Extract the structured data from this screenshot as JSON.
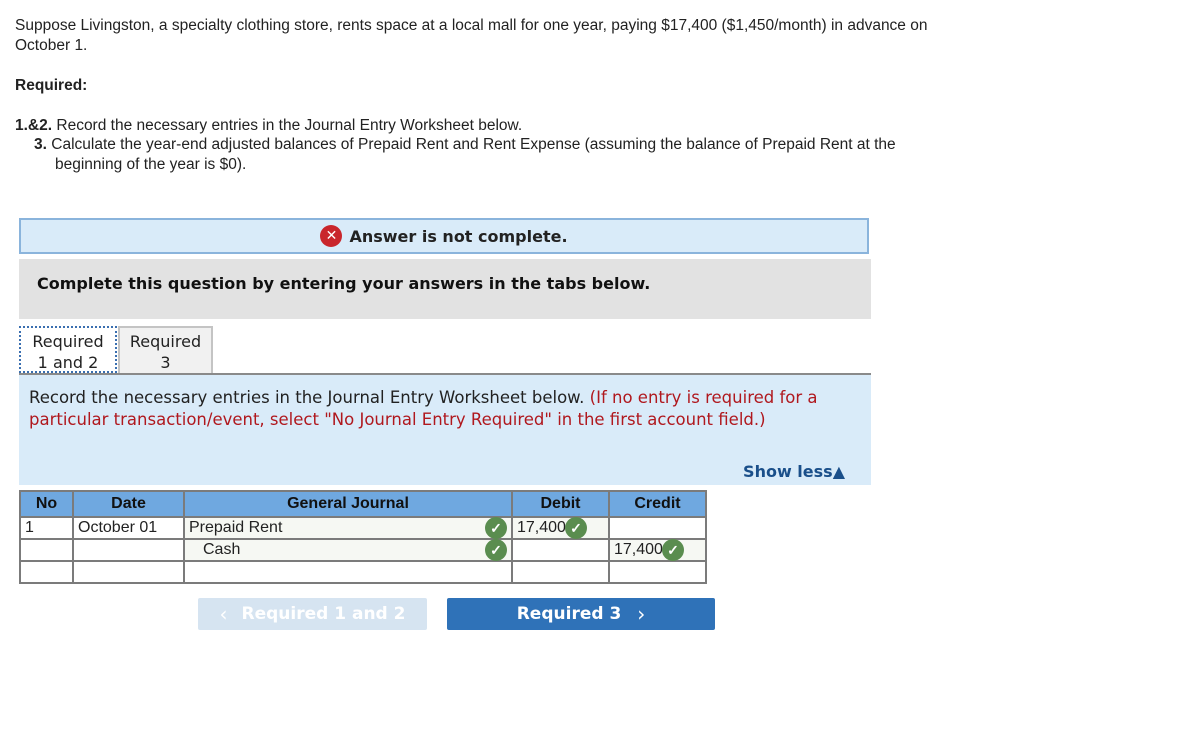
{
  "problem": {
    "text": "Suppose Livingston, a specialty clothing store, rents space at a local mall for one year, paying $17,400 ($1,450/month) in advance on October 1."
  },
  "required": {
    "title": "Required:",
    "items": [
      {
        "num": "1.&2.",
        "text": "Record the necessary entries in the Journal Entry Worksheet below."
      },
      {
        "num": "3.",
        "text": "Calculate the year-end adjusted balances of Prepaid Rent and Rent Expense (assuming the balance of Prepaid Rent at the beginning of the year is $0)."
      }
    ]
  },
  "status_banner": {
    "icon": "x-circle-icon",
    "text": "Answer is not complete.",
    "color": "#c9262c"
  },
  "instruction_box": {
    "text": "Complete this question by entering your answers in the tabs below."
  },
  "tabs": [
    {
      "line1": "Required",
      "line2": "1 and 2",
      "active": true
    },
    {
      "line1": "Required",
      "line2": "3",
      "active": false
    }
  ],
  "tab_content": {
    "instruction": "Record the necessary entries in the Journal Entry Worksheet below.",
    "note": "(If no entry is required for a particular transaction/event, select \"No Journal Entry Required\" in the first account field.)",
    "show_less": "Show less",
    "show_less_icon": "▲"
  },
  "journal": {
    "headers": [
      "No",
      "Date",
      "General Journal",
      "Debit",
      "Credit"
    ],
    "rows": [
      {
        "no": "1",
        "date": "October 01",
        "account": "Prepaid Rent",
        "debit": "17,400",
        "credit": "",
        "account_correct": true,
        "debit_correct": true,
        "credit_correct": false
      },
      {
        "no": "",
        "date": "",
        "account": "Cash",
        "debit": "",
        "credit": "17,400",
        "account_correct": true,
        "debit_correct": false,
        "credit_correct": true
      },
      {
        "no": "",
        "date": "",
        "account": "",
        "debit": "",
        "credit": ""
      }
    ],
    "check_color": "#5a8d4f"
  },
  "navigation": {
    "prev_label": "Required 1 and 2",
    "next_label": "Required 3",
    "prev_icon": "‹",
    "next_icon": "›",
    "next_color": "#2f72b8"
  }
}
